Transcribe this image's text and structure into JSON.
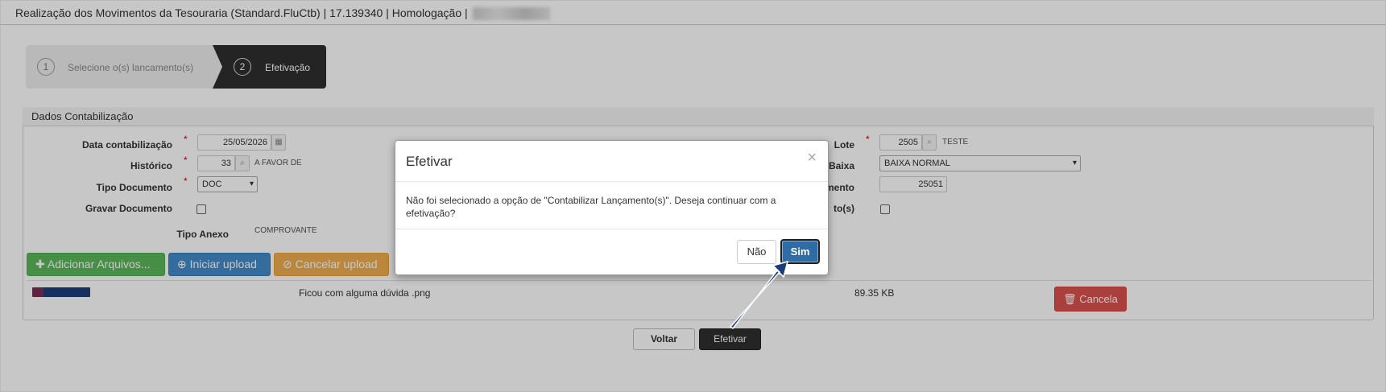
{
  "window": {
    "title": "Realização dos Movimentos da Tesouraria (Standard.FluCtb) | 17.139340 | Homologação |"
  },
  "wizard": {
    "steps": [
      {
        "number": "1",
        "label": "Selecione o(s) lancamento(s)"
      },
      {
        "number": "2",
        "label": "Efetivação"
      }
    ]
  },
  "panel": {
    "title": "Dados Contabilização",
    "left": {
      "data_label": "Data contabilização",
      "data_value": "25/05/2026",
      "historico_label": "Histórico",
      "historico_value": "33",
      "historico_hint": "A FAVOR DE",
      "tipo_doc_label": "Tipo Documento",
      "tipo_doc_value": "DOC",
      "gravar_label": "Gravar Documento",
      "tipo_anexo_label": "Tipo Anexo",
      "tipo_anexo_value": "COMPROVANTE"
    },
    "right": {
      "lote_label": "Lote",
      "lote_value": "2505",
      "lote_hint": "TESTE",
      "baixa_label": "Baixa",
      "baixa_value": "BAIXA NORMAL",
      "documento_label": "mento",
      "documento_value": "25051",
      "lancamentos_label": "to(s)"
    }
  },
  "upload": {
    "add_label": "Adicionar Arquivos...",
    "start_label": "Iniciar upload",
    "cancel_label": "Cancelar upload",
    "file": {
      "name": "Ficou com alguma dúvida .png",
      "size": "89.35 KB",
      "cancel_label": "Cancela"
    }
  },
  "footer": {
    "voltar_label": "Voltar",
    "efetivar_label": "Efetivar"
  },
  "modal": {
    "title": "Efetivar",
    "close_glyph": "×",
    "message": "Não foi selecionado a opção de \"Contabilizar Lançamento(s)\". Deseja continuar com a efetivação?",
    "no_label": "Não",
    "yes_label": "Sim"
  },
  "icons": {
    "calendar": "calendar-icon",
    "search": "search-icon",
    "plus": "plus-icon",
    "upload": "upload-icon",
    "ban": "ban-icon",
    "trash": "trash-icon"
  },
  "colors": {
    "step_active": "#2f2f2f",
    "success": "#5cb85c",
    "primary": "#428bca",
    "warning": "#f0ad4e",
    "danger": "#d9534f",
    "sim": "#2f6ca6",
    "required": "#cc0000"
  }
}
